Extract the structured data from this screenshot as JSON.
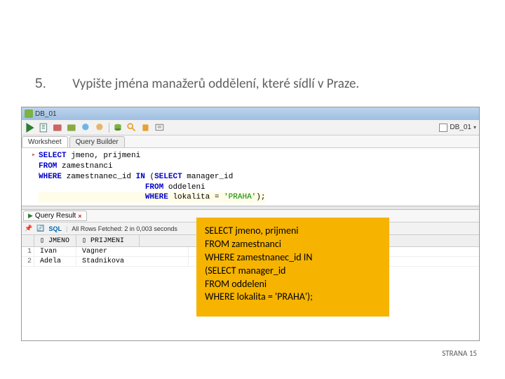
{
  "heading": {
    "number": "5.",
    "text": "Vypište jména manažerů oddělení, které sídlí v Praze."
  },
  "titlebar": {
    "db_name": "DB_01"
  },
  "toolbar_right": {
    "db_label": "DB_01"
  },
  "tabs": {
    "worksheet": "Worksheet",
    "builder": "Query Builder"
  },
  "sql": {
    "l1_kw": "SELECT ",
    "l1_rest": "jmeno, prijmeni",
    "l2_kw": "FROM ",
    "l2_rest": "zamestnanci",
    "l3_kw": "WHERE ",
    "l3_a": "zamestnanec_id ",
    "l3_in": "IN ",
    "l3_b": "(",
    "l3_sel": "SELECT ",
    "l3_c": "manager_id",
    "l4_pad": "                       ",
    "l4_kw": "FROM ",
    "l4_rest": "oddeleni",
    "l5_pad": "                       ",
    "l5_kw": "WHERE ",
    "l5_a": "lokalita = ",
    "l5_str": "'PRAHA'",
    "l5_end": ");"
  },
  "result_tab": {
    "label": "Query Result"
  },
  "result_toolbar": {
    "sql": "SQL",
    "status": "All Rows Fetched: 2 in 0,003 seconds"
  },
  "grid": {
    "headers": {
      "c1": "JMENO",
      "c2": "PRIJMENI"
    },
    "rows": [
      {
        "n": "1",
        "c1": "Ivan",
        "c2": "Vagner"
      },
      {
        "n": "2",
        "c1": "Adela",
        "c2": "Stadnikova"
      }
    ]
  },
  "overlay": {
    "l1": "SELECT jmeno, prijmeni",
    "l2": "FROM zamestnanci",
    "l3": "WHERE zamestnanec_id IN",
    "l4": " (SELECT manager_id",
    "l5": " FROM oddeleni",
    "l6": " WHERE lokalita = 'PRAHA');"
  },
  "footer": {
    "page_label": "STRANA 15"
  }
}
